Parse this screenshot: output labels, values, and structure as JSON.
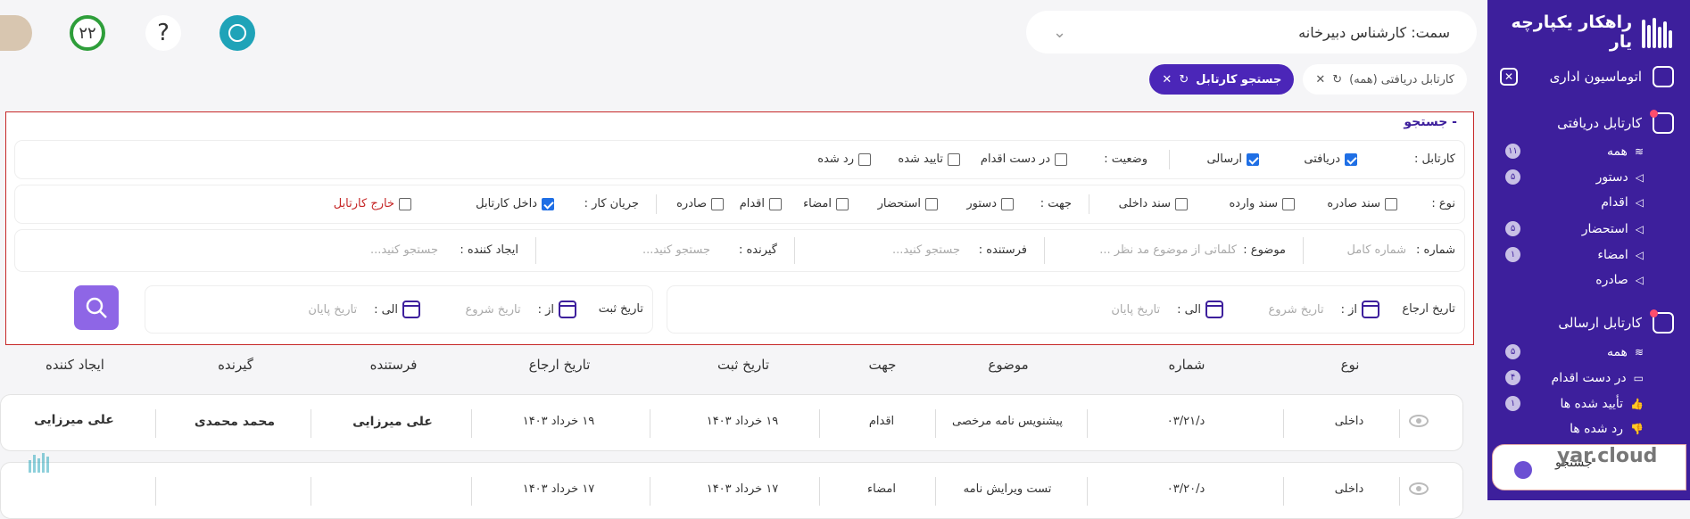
{
  "sidebar": {
    "brand": "راهکار یکپارچه یار",
    "automation": "اتوماسیون اداری",
    "received": {
      "title": "کارتابل دریافتی",
      "items": [
        {
          "label": "همه",
          "badge": "۱۱"
        },
        {
          "label": "دستور",
          "badge": "۵"
        },
        {
          "label": "اقدام",
          "badge": ""
        },
        {
          "label": "استحضار",
          "badge": "۵"
        },
        {
          "label": "امضاء",
          "badge": "۱"
        },
        {
          "label": "صادره",
          "badge": ""
        }
      ]
    },
    "sent": {
      "title": "کارتابل ارسالی",
      "items": [
        {
          "label": "همه",
          "badge": "۵"
        },
        {
          "label": "در دست اقدام",
          "badge": "۴"
        },
        {
          "label": "تأیید شده ها",
          "badge": "۱"
        },
        {
          "label": "رد شده ها",
          "badge": ""
        }
      ]
    },
    "search_item": "جستجو",
    "watermark": "yar.cloud"
  },
  "header": {
    "role_prefix": "سمت:",
    "role_value": "کارشناس دبیرخانه",
    "progress_value": "۲۲",
    "help": "?"
  },
  "tabs": [
    {
      "label": "کارتابل دریافتی (همه)"
    },
    {
      "label": "جستجو کارتابل"
    }
  ],
  "search": {
    "title": "- جستجو",
    "cartable_label": "کارتابل :",
    "cartable_options": [
      {
        "label": "دریافتی",
        "checked": true
      },
      {
        "label": "ارسالی",
        "checked": true
      }
    ],
    "status_label": "وضعیت :",
    "status_options": [
      {
        "label": "در دست اقدام",
        "checked": false
      },
      {
        "label": "تایید شده",
        "checked": false
      },
      {
        "label": "رد شده",
        "checked": false
      }
    ],
    "type_label": "نوع :",
    "type_options": [
      {
        "label": "سند صادره",
        "checked": false
      },
      {
        "label": "سند وارده",
        "checked": false
      },
      {
        "label": "سند داخلی",
        "checked": false
      }
    ],
    "direction_label": "جهت :",
    "direction_options": [
      {
        "label": "دستور",
        "checked": false
      },
      {
        "label": "استحضار",
        "checked": false
      },
      {
        "label": "امضاء",
        "checked": false
      },
      {
        "label": "اقدام",
        "checked": false
      },
      {
        "label": "صادره",
        "checked": false
      }
    ],
    "workflow_label": "جریان کار :",
    "workflow_options": [
      {
        "label": "داخل کارتابل",
        "checked": true
      },
      {
        "label": "خارج کارتابل",
        "checked": false
      }
    ],
    "number_label": "شماره :",
    "number_placeholder": "شماره کامل",
    "subject_label": "موضوع :",
    "subject_placeholder": "کلماتی از موضوع مد نظر ...",
    "sender_label": "فرستنده :",
    "sender_placeholder": "جستجو کنید...",
    "receiver_label": "گیرنده :",
    "receiver_placeholder": "جستجو کنید...",
    "creator_label": "ایجاد کننده :",
    "creator_placeholder": "جستجو کنید...",
    "refer_date_label": "تاریخ ارجاع",
    "reg_date_label": "تاریخ ثبت",
    "from_label": "از :",
    "to_label": "الی :",
    "start_placeholder": "تاریخ شروع",
    "end_placeholder": "تاریخ پایان"
  },
  "table": {
    "headers": [
      "نوع",
      "شماره",
      "موضوع",
      "جهت",
      "تاریخ ثبت",
      "تاریخ ارجاع",
      "فرستنده",
      "گیرنده",
      "ایجاد کننده"
    ],
    "rows": [
      [
        "داخلی",
        "د/۰۳/۲۱",
        "پیشنویس نامه مرخصی",
        "اقدام",
        "۱۹ خرداد ۱۴۰۳",
        "۱۹ خرداد ۱۴۰۳",
        "علی میرزایی",
        "محمد محمدی",
        "علی میرزایی"
      ],
      [
        "داخلی",
        "د/۰۳/۲۰",
        "تست ویرایش نامه",
        "امضاء",
        "۱۷ خرداد ۱۴۰۳",
        "۱۷ خرداد ۱۴۰۳",
        "",
        "",
        ""
      ]
    ]
  },
  "colors": {
    "primary": "#3d1f9c",
    "accent": "#8e66e6",
    "teal": "#1fa3b8",
    "green": "#2e9e3a"
  }
}
